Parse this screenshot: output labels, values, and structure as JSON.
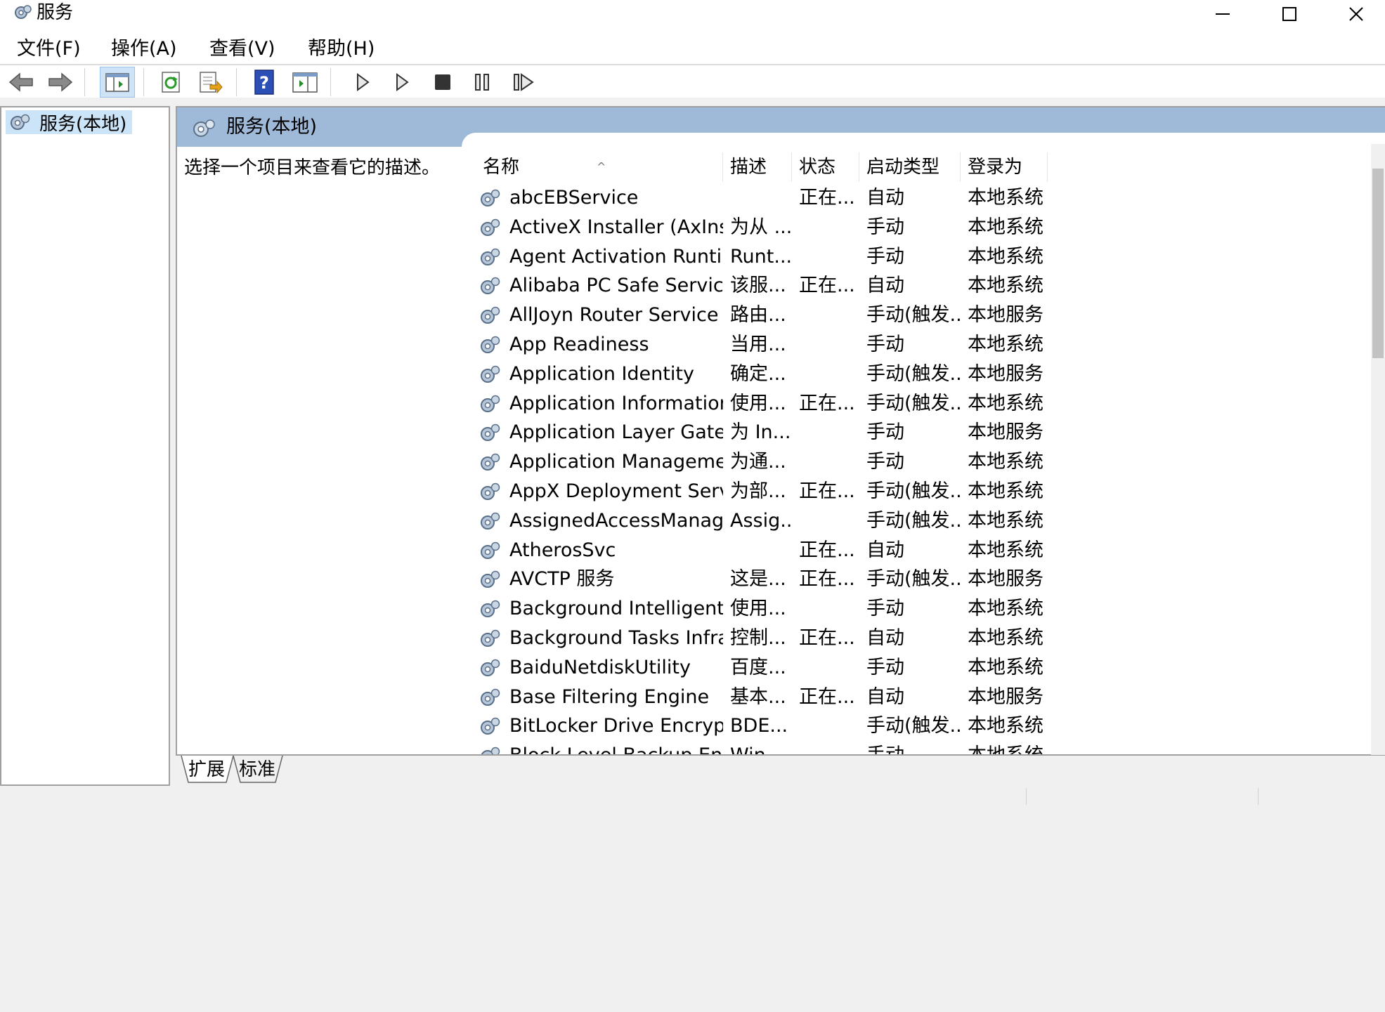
{
  "window": {
    "title": "服务"
  },
  "menu": [
    "文件(F)",
    "操作(A)",
    "查看(V)",
    "帮助(H)"
  ],
  "toolbar": [
    "back-icon",
    "forward-icon",
    "show-tree-icon",
    "refresh-icon",
    "export-list-icon",
    "help-icon",
    "properties-icon",
    "start-icon",
    "start-alt-icon",
    "stop-icon",
    "pause-icon",
    "resume-icon"
  ],
  "tree": {
    "node_label": "服务(本地)"
  },
  "pane": {
    "header_title": "服务(本地)",
    "description": "选择一个项目来查看它的描述。"
  },
  "columns": [
    "名称",
    "描述",
    "状态",
    "启动类型",
    "登录为"
  ],
  "rows": [
    [
      "abcEBService",
      "",
      "正在...",
      "自动",
      "本地系统"
    ],
    [
      "ActiveX Installer (AxInstSV)",
      "为从 ...",
      "",
      "手动",
      "本地系统"
    ],
    [
      "Agent Activation Runtime_...",
      "Runt...",
      "",
      "手动",
      "本地系统"
    ],
    [
      "Alibaba PC Safe Service",
      "该服...",
      "正在...",
      "自动",
      "本地系统"
    ],
    [
      "AllJoyn Router Service",
      "路由...",
      "",
      "手动(触发...",
      "本地服务"
    ],
    [
      "App Readiness",
      "当用...",
      "",
      "手动",
      "本地系统"
    ],
    [
      "Application Identity",
      "确定...",
      "",
      "手动(触发...",
      "本地服务"
    ],
    [
      "Application Information",
      "使用...",
      "正在...",
      "手动(触发...",
      "本地系统"
    ],
    [
      "Application Layer Gateway ...",
      "为 In...",
      "",
      "手动",
      "本地服务"
    ],
    [
      "Application Management",
      "为通...",
      "",
      "手动",
      "本地系统"
    ],
    [
      "AppX Deployment Service (...",
      "为部...",
      "正在...",
      "手动(触发...",
      "本地系统"
    ],
    [
      "AssignedAccessManager 服...",
      "Assig...",
      "",
      "手动(触发...",
      "本地系统"
    ],
    [
      "AtherosSvc",
      "",
      "正在...",
      "自动",
      "本地系统"
    ],
    [
      "AVCTP 服务",
      "这是...",
      "正在...",
      "手动(触发...",
      "本地服务"
    ],
    [
      "Background Intelligent Tran...",
      "使用...",
      "",
      "手动",
      "本地系统"
    ],
    [
      "Background Tasks Infrastru...",
      "控制...",
      "正在...",
      "自动",
      "本地系统"
    ],
    [
      "BaiduNetdiskUtility",
      "百度...",
      "",
      "手动",
      "本地系统"
    ],
    [
      "Base Filtering Engine",
      "基本...",
      "正在...",
      "自动",
      "本地服务"
    ],
    [
      "BitLocker Drive Encryption ...",
      "BDE...",
      "",
      "手动(触发...",
      "本地系统"
    ],
    [
      "Block Level Backup Engine ...",
      "Win...",
      "",
      "手动",
      "本地系统"
    ]
  ],
  "tabs": [
    "扩展",
    "标准"
  ]
}
